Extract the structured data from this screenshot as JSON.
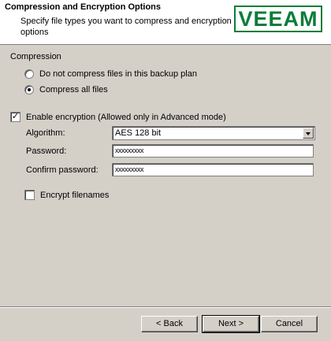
{
  "header": {
    "title": "Compression and Encryption Options",
    "subtitle": "Specify file types you want to compress and encryption options",
    "logo_text": "VEEAM"
  },
  "compression": {
    "section_label": "Compression",
    "options": [
      {
        "label": "Do not compress files in this backup plan",
        "selected": false
      },
      {
        "label": "Compress all files",
        "selected": true
      }
    ]
  },
  "encryption": {
    "enable_label": "Enable encryption (Allowed only in Advanced mode)",
    "enabled": true,
    "algorithm_label": "Algorithm:",
    "algorithm_value": "AES 128 bit",
    "password_label": "Password:",
    "password_value": "xxxxxxxxx",
    "confirm_label": "Confirm password:",
    "confirm_value": "xxxxxxxxx",
    "encrypt_filenames_label": "Encrypt filenames",
    "encrypt_filenames": false
  },
  "footer": {
    "back_label": "< Back",
    "next_label": "Next >",
    "cancel_label": "Cancel"
  },
  "colors": {
    "brand": "#0b7d3a",
    "dialog_bg": "#d4d0c8"
  }
}
